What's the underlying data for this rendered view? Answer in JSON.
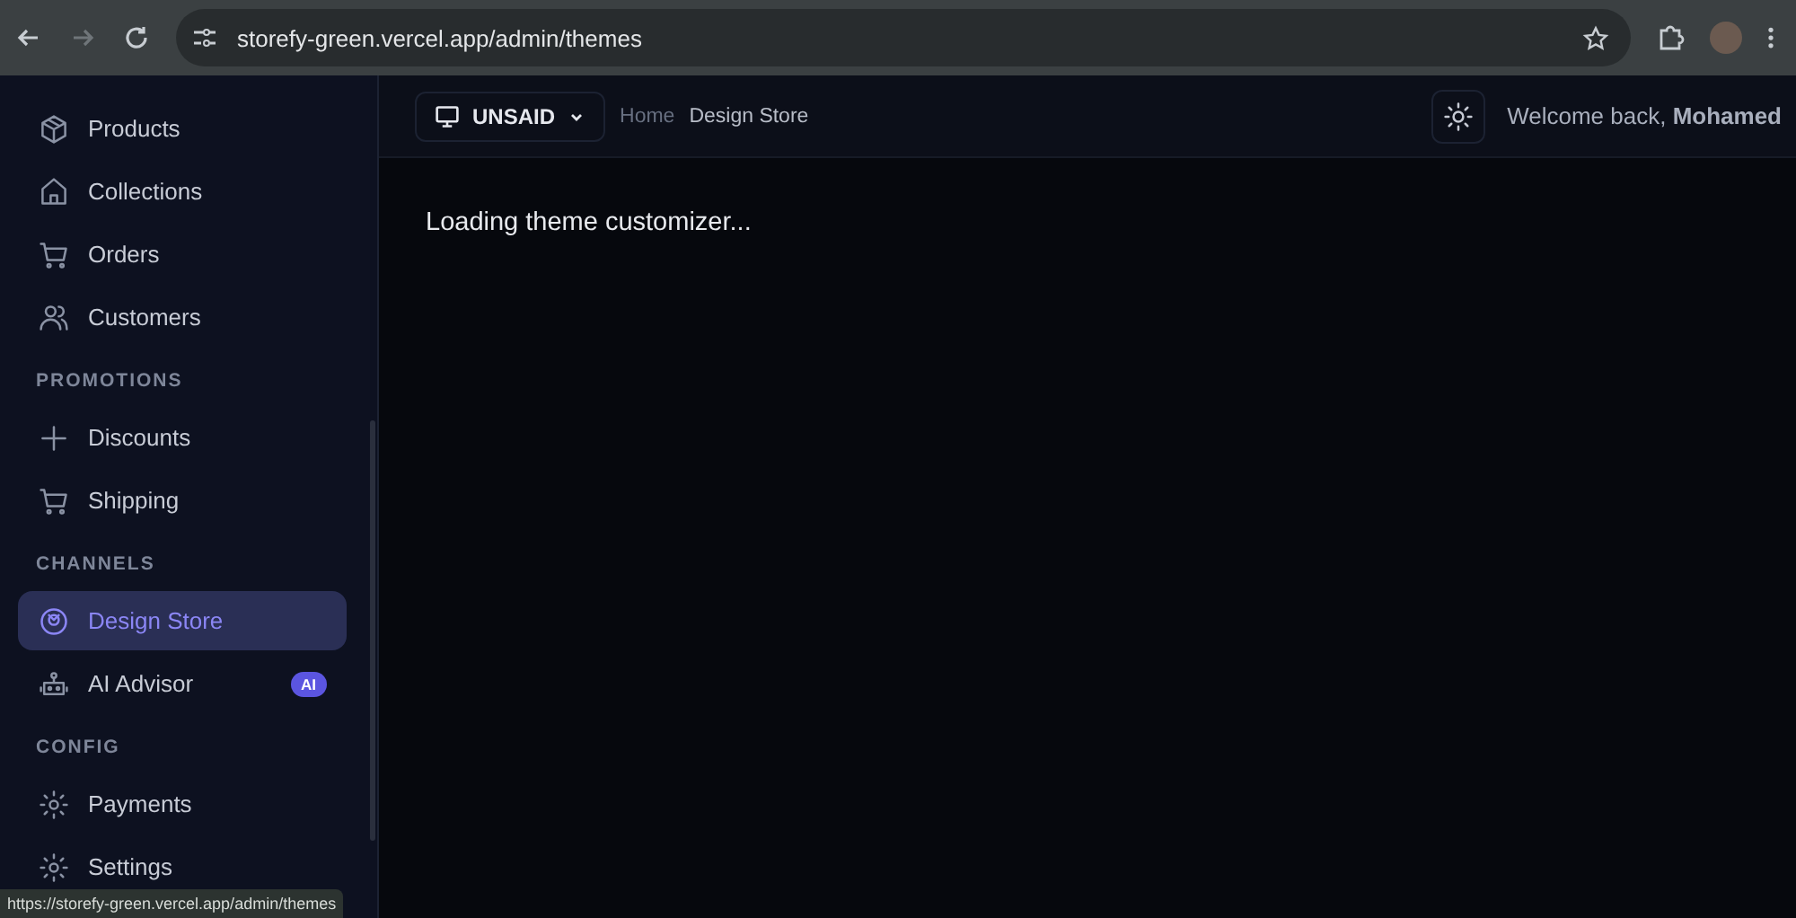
{
  "browser": {
    "url": "storefy-green.vercel.app/admin/themes",
    "status_link": "https://storefy-green.vercel.app/admin/themes"
  },
  "sidebar": {
    "sections": [
      {
        "items": [
          {
            "label": "Products",
            "selected": false
          },
          {
            "label": "Collections",
            "selected": false
          },
          {
            "label": "Orders",
            "selected": false
          },
          {
            "label": "Customers",
            "selected": false
          }
        ]
      },
      {
        "label": "PROMOTIONS",
        "items": [
          {
            "label": "Discounts",
            "selected": false
          },
          {
            "label": "Shipping",
            "selected": false
          }
        ]
      },
      {
        "label": "CHANNELS",
        "items": [
          {
            "label": "Design Store",
            "selected": true
          },
          {
            "label": "AI Advisor",
            "selected": false,
            "badge": "AI"
          }
        ]
      },
      {
        "label": "CONFIG",
        "items": [
          {
            "label": "Payments",
            "selected": false
          },
          {
            "label": "Settings",
            "selected": false
          }
        ]
      }
    ]
  },
  "header": {
    "store": "UNSAID",
    "breadcrumbs": [
      "Home",
      "Design Store"
    ],
    "welcome": "Welcome back, **Mohamed**"
  },
  "content": {
    "message": "Loading theme customizer..."
  }
}
